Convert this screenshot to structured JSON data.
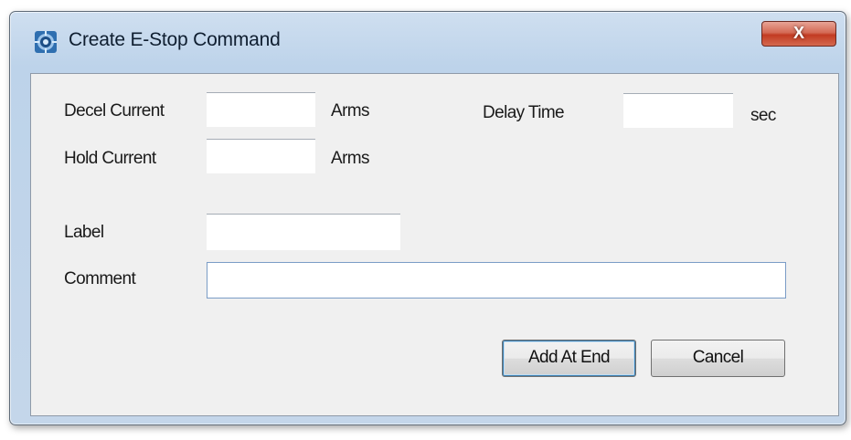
{
  "window": {
    "title": "Create E-Stop Command",
    "close_label": "X"
  },
  "form": {
    "decel_current": {
      "label": "Decel Current",
      "value": "",
      "unit": "Arms"
    },
    "hold_current": {
      "label": "Hold Current",
      "value": "",
      "unit": "Arms"
    },
    "delay_time": {
      "label": "Delay Time",
      "value": "",
      "unit": "sec"
    },
    "label_field": {
      "label": "Label",
      "value": ""
    },
    "comment": {
      "label": "Comment",
      "value": ""
    }
  },
  "buttons": {
    "add_at_end": "Add At End",
    "cancel": "Cancel"
  },
  "colors": {
    "titlebar": "#bdd3ea",
    "close_button": "#c23b22",
    "client_bg": "#f0f0f0"
  }
}
